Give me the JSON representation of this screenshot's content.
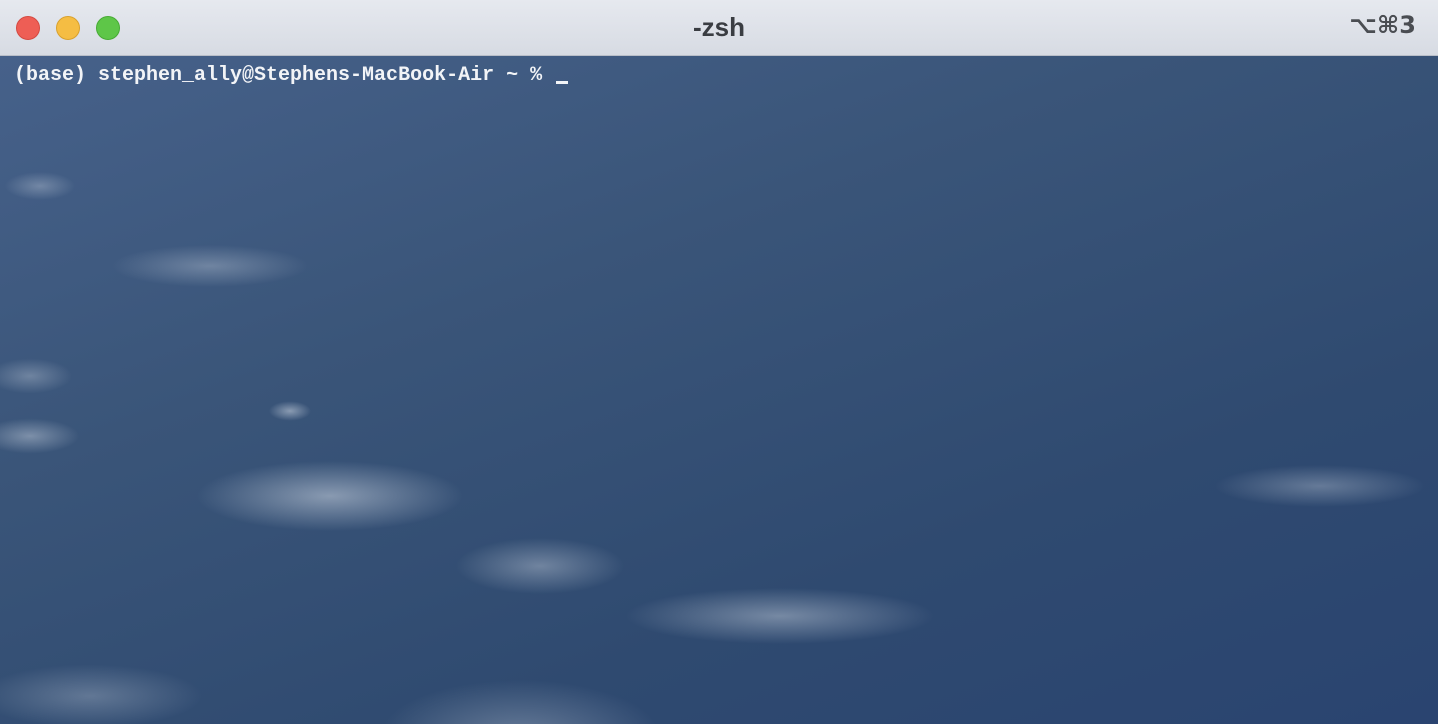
{
  "window": {
    "title": "-zsh",
    "shortcut": "⌥⌘3"
  },
  "terminal": {
    "prompt": "(base) stephen_ally@Stephens-MacBook-Air ~ % "
  },
  "colors": {
    "close": "#ee5e55",
    "minimize": "#f5bd43",
    "zoom": "#5ec648",
    "text": "#f2f4f7"
  },
  "icons": [
    "close-button",
    "minimize-button",
    "zoom-button"
  ]
}
